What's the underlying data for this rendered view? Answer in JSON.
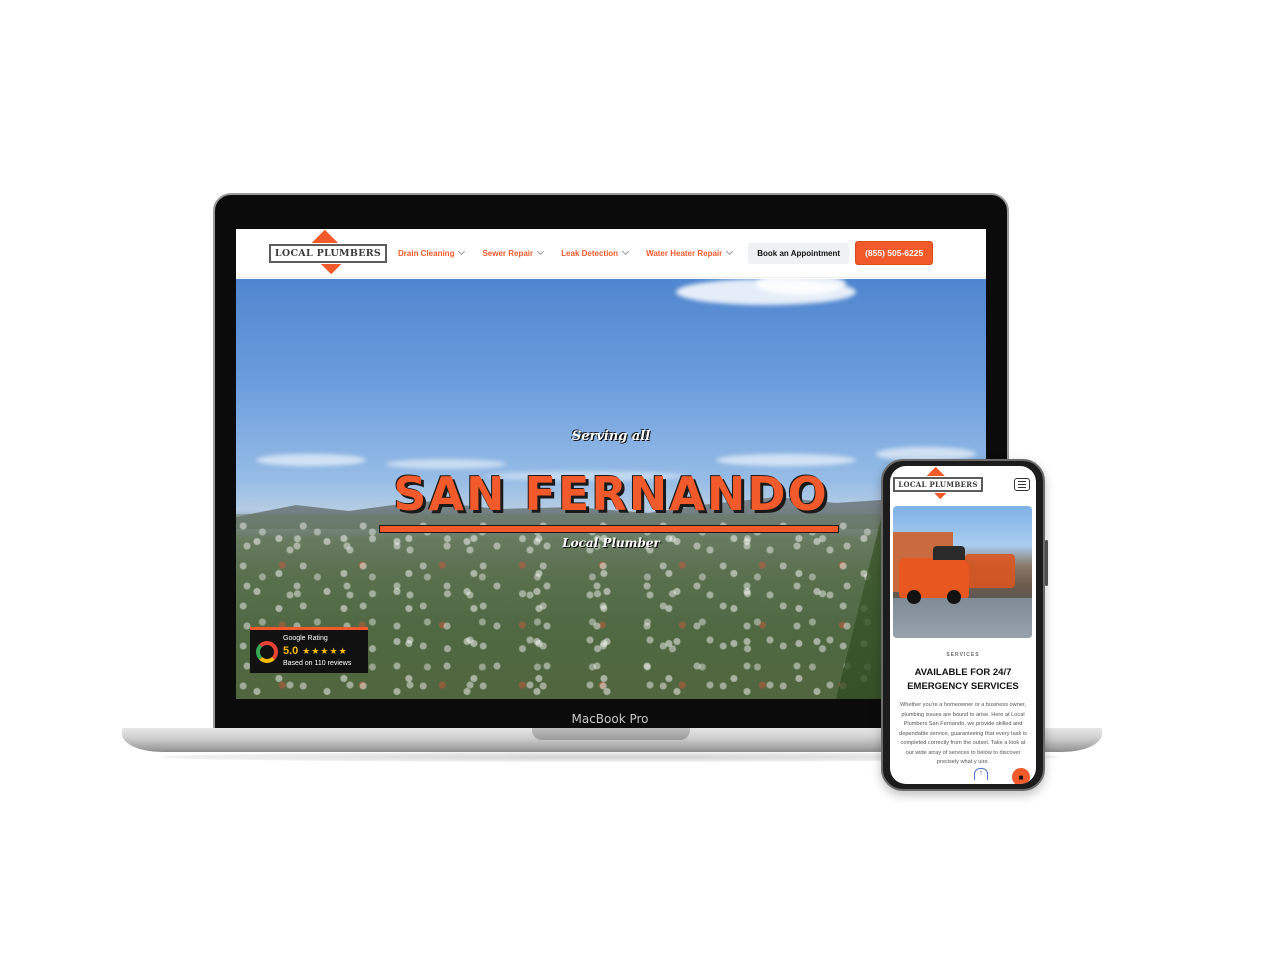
{
  "laptop": {
    "device_label": "MacBook Pro",
    "header": {
      "logo_text": "LOCAL PLUMBERS",
      "nav": [
        {
          "label": "Drain Cleaning"
        },
        {
          "label": "Sewer Repair"
        },
        {
          "label": "Leak Detection"
        },
        {
          "label": "Water Heater Repair"
        }
      ],
      "book_button": "Book an Appointment",
      "phone_button": "(855) 505-6225"
    },
    "hero": {
      "pretitle": "Serving all",
      "title": "SAN FERNANDO",
      "subtitle": "Local Plumber"
    },
    "rating": {
      "label": "Google Rating",
      "score": "5.0",
      "stars": "★★★★★",
      "reviews": "Based on 110 reviews"
    }
  },
  "phone": {
    "logo_text": "LOCAL PLUMBERS",
    "section_label": "SERVICES",
    "heading_line1": "AVAILABLE FOR 24/7",
    "heading_line2": "EMERGENCY SERVICES",
    "body": "Whether you're a homeowner or a business owner, plumbing issues are bound to arise. Here at Local Plumbers San Fernando, we provide skilled and dependable service, guaranteeing that every task is completed correctly from the outset. Take a look at our wide array of services to below to discover precisely what y  uire."
  },
  "colors": {
    "brand_orange": "#f25a2b",
    "dark": "#111111",
    "star_gold": "#fbbc05"
  }
}
